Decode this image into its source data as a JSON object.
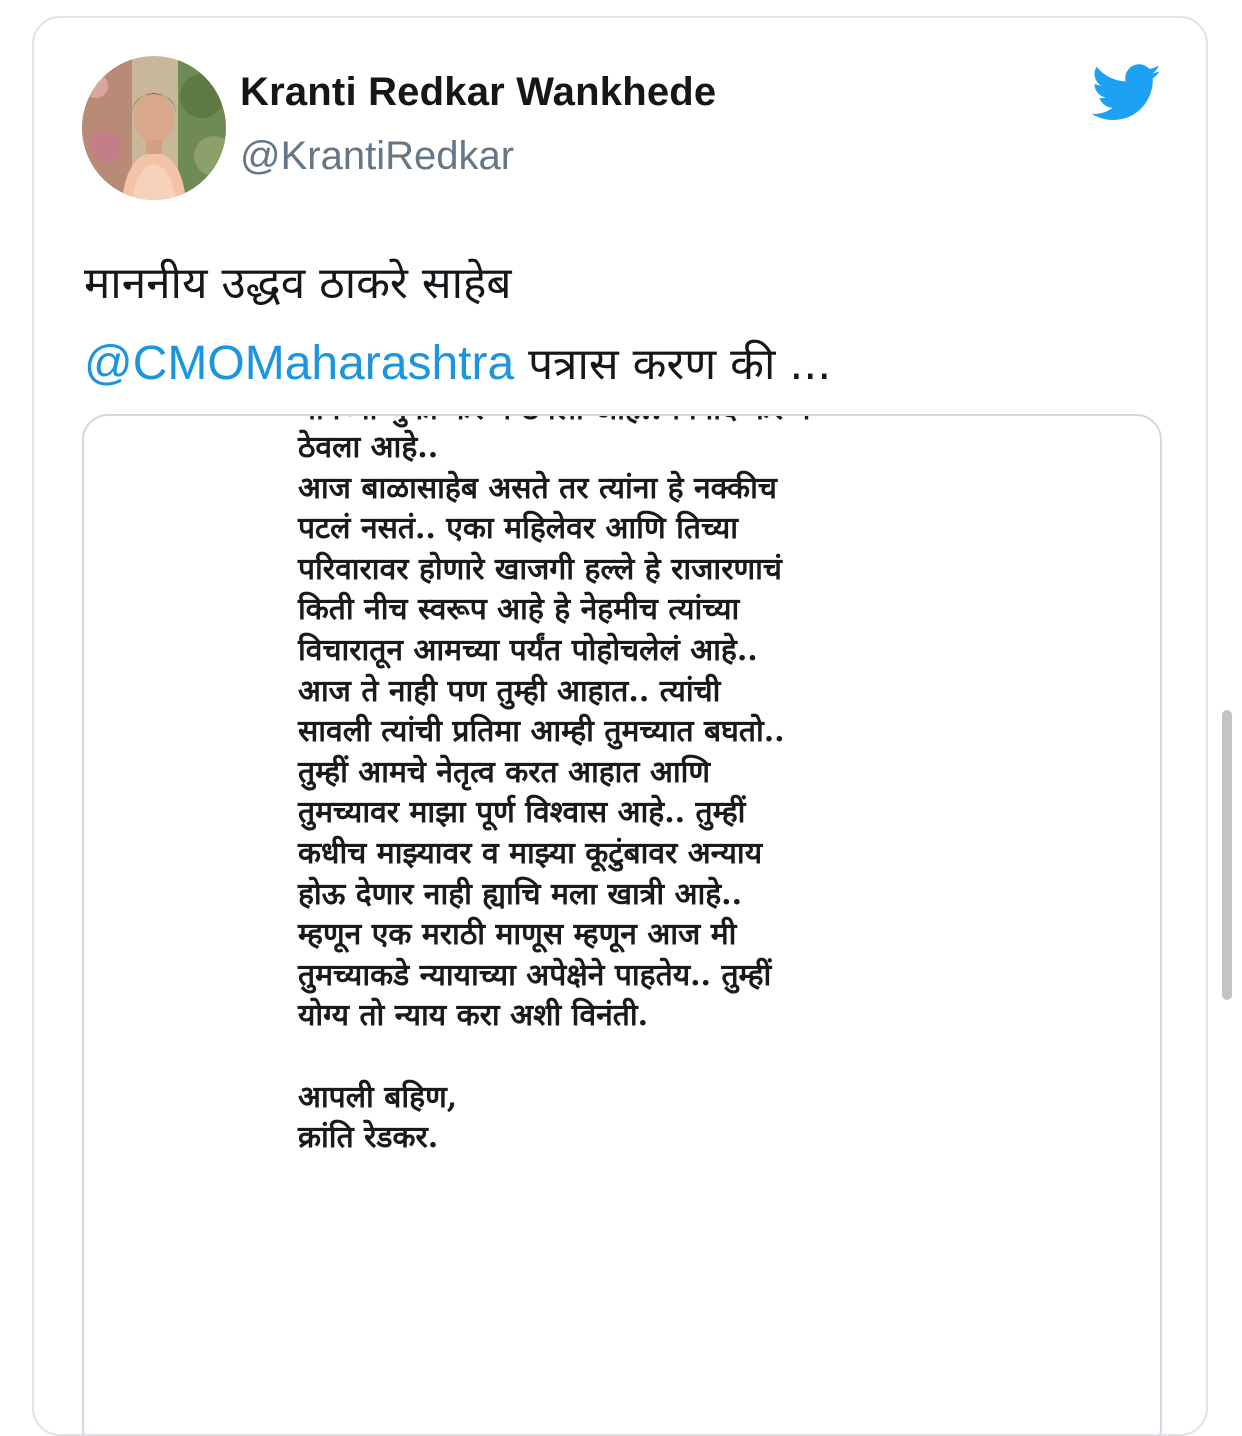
{
  "tweet": {
    "display_name": "Kranti Redkar Wankhede",
    "handle": "@KrantiRedkar",
    "avatar_icon": "user-avatar",
    "logo_icon": "twitter-bird-icon",
    "text_line1": "माननीय उद्धव ठाकरे साहेब",
    "mention": "@CMOMaharashtra",
    "text_line2_rest": " पत्रास करण की ...",
    "accent_color": "#1b95e0"
  },
  "letter": {
    "cut_top": "मानेच्या चुका करून ठेवला आहे.. विनाद करून",
    "lines": [
      "ठेवला आहे..",
      "आज बाळासाहेब असते तर त्यांना हे नक्कीच",
      "पटलं नसतं.. एका महिलेवर आणि तिच्या",
      "परिवारावर होणारे खाजगी हल्ले हे राजारणाचं",
      "किती नीच स्वरूप आहे हे नेहमीच त्यांच्या",
      "विचारातून आमच्या पर्यंत पोहोचलेलं आहे..",
      "आज ते नाही पण तुम्ही आहात..  त्यांची",
      "सावली त्यांची प्रतिमा आम्ही तुमच्यात बघतो..",
      "तुम्हीं आमचे नेतृत्व करत आहात आणि",
      "तुमच्यावर माझा पूर्ण विश्वास आहे.. तुम्हीं",
      "कधीच माझ्यावर व माझ्या कूटुंबावर अन्याय",
      "होऊ देणार नाही ह्याचि मला खात्री आहे..",
      "म्हणून एक मराठी माणूस म्हणून आज मी",
      "तुमच्याकडे न्यायाच्या अपेक्षेने पाहतेय.. तुम्हीं",
      "योग्य तो न्याय करा अशी विनंती."
    ],
    "closing": [
      "आपली बहिण,",
      "क्रांति रेडकर."
    ]
  }
}
